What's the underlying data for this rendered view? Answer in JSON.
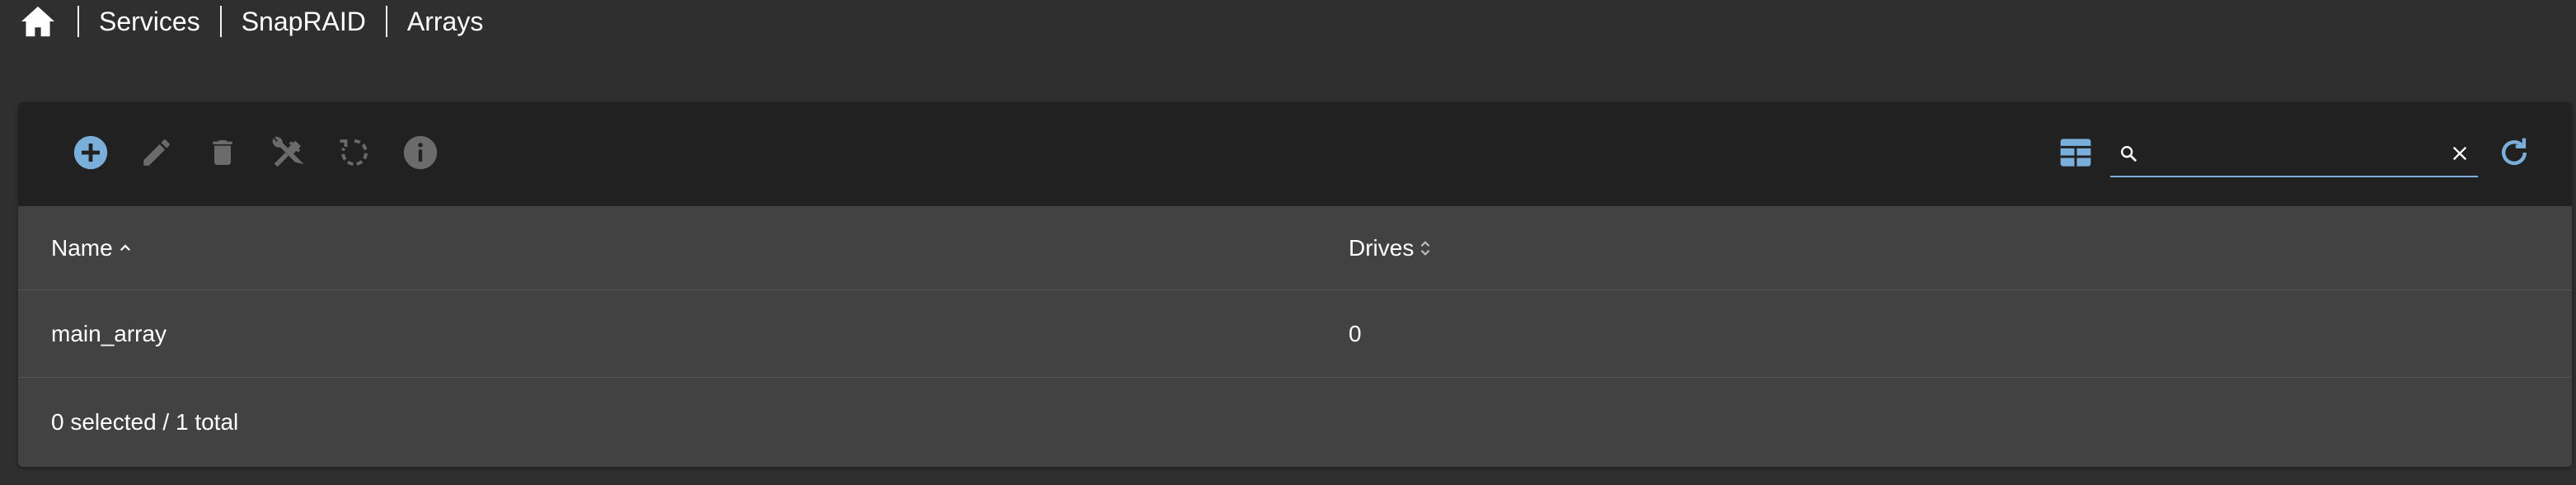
{
  "breadcrumb": {
    "home_icon": "home-icon",
    "items": [
      "Services",
      "SnapRAID",
      "Arrays"
    ]
  },
  "toolbar": {
    "buttons": [
      {
        "name": "add-button",
        "icon": "plus-circle-icon",
        "enabled": true
      },
      {
        "name": "edit-button",
        "icon": "pencil-icon",
        "enabled": false
      },
      {
        "name": "delete-button",
        "icon": "trash-icon",
        "enabled": false
      },
      {
        "name": "tools-button",
        "icon": "wrench-screwdriver-icon",
        "enabled": false
      },
      {
        "name": "restore-button",
        "icon": "restore-icon",
        "enabled": false
      },
      {
        "name": "info-button",
        "icon": "info-icon",
        "enabled": false
      }
    ],
    "search": {
      "value": "",
      "placeholder": ""
    },
    "accent_color": "#7aaedb",
    "disabled_color": "#6b6b6b"
  },
  "table": {
    "columns": [
      {
        "label": "Name",
        "sort": "ascending"
      },
      {
        "label": "Drives",
        "sort": "none"
      }
    ],
    "rows": [
      {
        "name": "main_array",
        "drives": "0"
      }
    ],
    "footer": "0 selected / 1 total"
  }
}
